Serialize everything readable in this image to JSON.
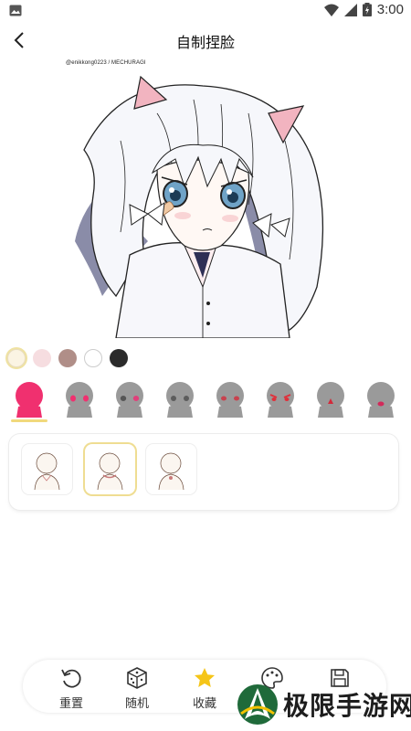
{
  "status_bar": {
    "time": "3:00"
  },
  "header": {
    "title": "自制捏脸"
  },
  "canvas": {
    "credit": "@enikkong0223 / MECHURAGI"
  },
  "colors": [
    {
      "hex": "#fbf4e3",
      "selected": true
    },
    {
      "hex": "#f6dde0",
      "selected": false
    },
    {
      "hex": "#b08e88",
      "selected": false
    },
    {
      "hex": "#ffffff",
      "selected": false
    },
    {
      "hex": "#2b2b2b",
      "selected": false
    }
  ],
  "heads": [
    {
      "icon": "head-color-icon",
      "selected": true
    },
    {
      "icon": "head-pink-eyes-icon"
    },
    {
      "icon": "head-pink-eyes-icon"
    },
    {
      "icon": "head-gray-eyes-icon"
    },
    {
      "icon": "head-red-eyes-icon"
    },
    {
      "icon": "head-angry-eyes-icon"
    },
    {
      "icon": "head-red-mark-icon"
    },
    {
      "icon": "head-red-mouth-icon"
    }
  ],
  "bodies": [
    {
      "icon": "body-sketch-icon",
      "selected": false
    },
    {
      "icon": "body-sketch-icon",
      "selected": true
    },
    {
      "icon": "body-sketch-icon",
      "selected": false
    }
  ],
  "toolbar": {
    "reset": "重置",
    "random": "随机",
    "favorite": "收藏",
    "palette": "",
    "save": ""
  },
  "watermark": {
    "text": "极限手游网"
  },
  "colors_theme": {
    "accent": "#f1d97c",
    "star": "#f5c518",
    "pink": "#f0306f"
  }
}
